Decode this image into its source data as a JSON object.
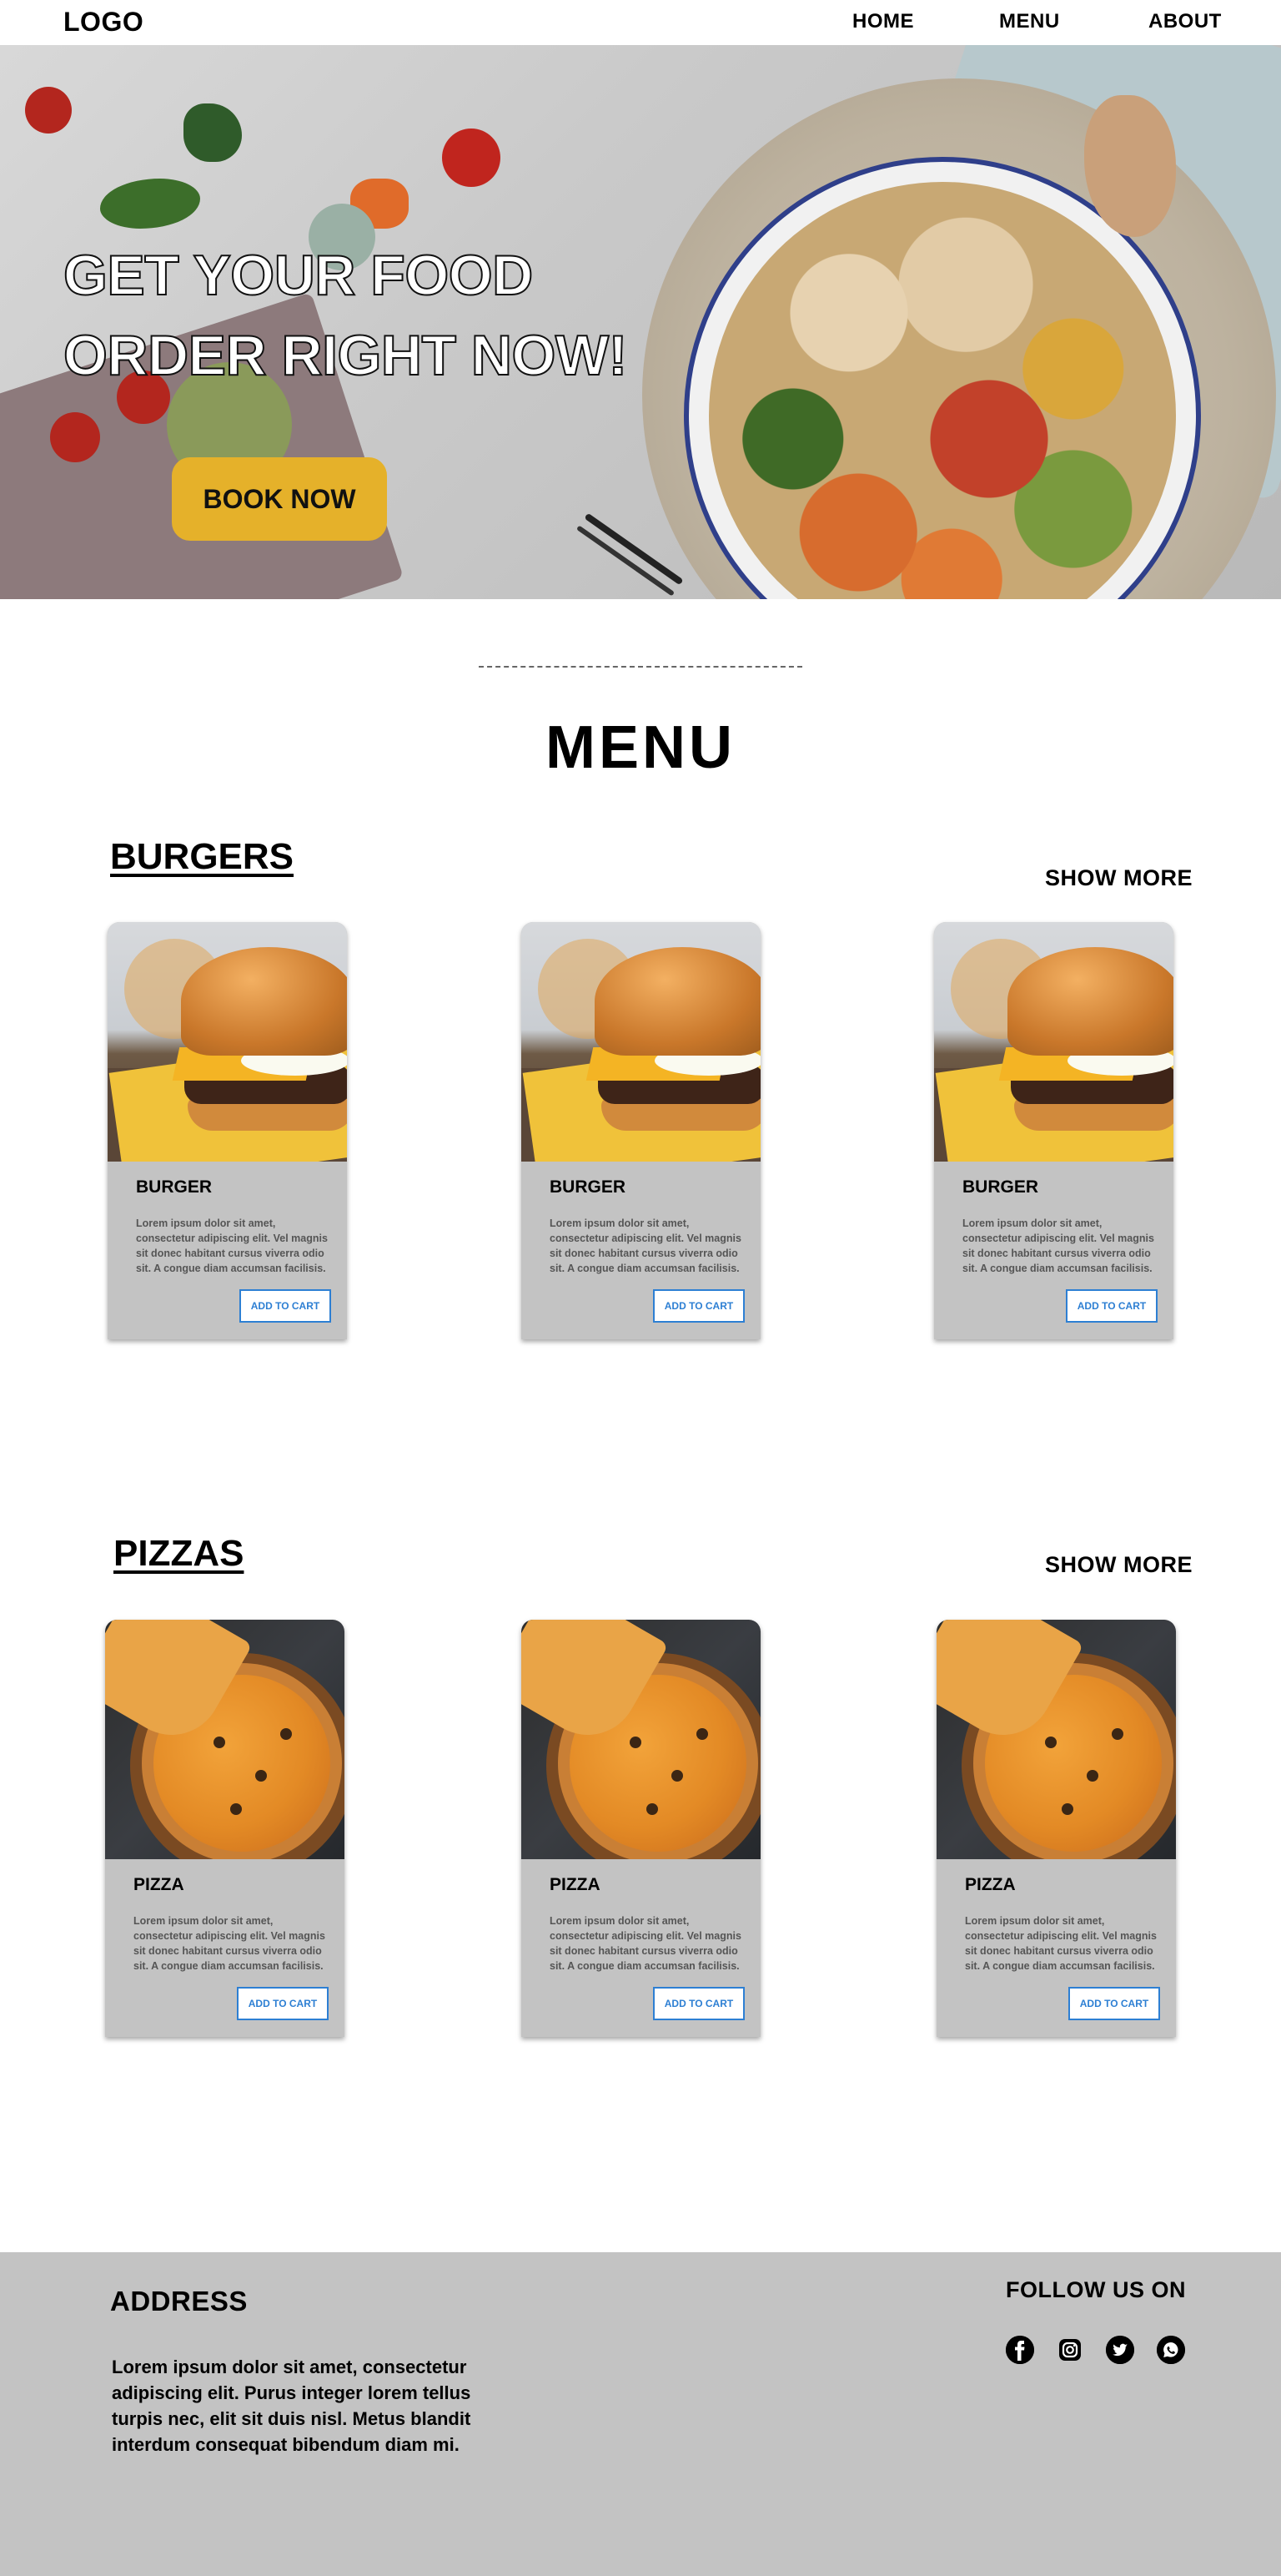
{
  "nav": {
    "logo": "LOGO",
    "links": [
      "HOME",
      "MENU",
      "ABOUT"
    ]
  },
  "hero": {
    "title_line1": "GET YOUR FOOD",
    "title_line2": "ORDER RIGHT NOW!",
    "cta": "BOOK NOW",
    "accent_color": "#e5b12a"
  },
  "menu": {
    "title": "MENU",
    "sections": [
      {
        "title": "BURGERS",
        "show_more": "SHOW MORE",
        "items": [
          {
            "name": "BURGER",
            "description": "Lorem ipsum dolor sit amet, consectetur adipiscing elit. Vel magnis sit donec habitant cursus viverra odio sit. A congue diam accumsan facilisis.",
            "button": "ADD TO CART"
          },
          {
            "name": "BURGER",
            "description": "Lorem ipsum dolor sit amet, consectetur adipiscing elit. Vel magnis sit donec habitant cursus viverra odio sit. A congue diam accumsan facilisis.",
            "button": "ADD TO CART"
          },
          {
            "name": "BURGER",
            "description": "Lorem ipsum dolor sit amet, consectetur adipiscing elit. Vel magnis sit donec habitant cursus viverra odio sit. A congue diam accumsan facilisis.",
            "button": "ADD TO CART"
          }
        ]
      },
      {
        "title": "PIZZAS",
        "show_more": "SHOW MORE",
        "items": [
          {
            "name": "PIZZA",
            "description": "Lorem ipsum dolor sit amet, consectetur adipiscing elit. Vel magnis sit donec habitant cursus viverra odio sit. A congue diam accumsan facilisis.",
            "button": "ADD TO CART"
          },
          {
            "name": "PIZZA",
            "description": "Lorem ipsum dolor sit amet, consectetur adipiscing elit. Vel magnis sit donec habitant cursus viverra odio sit. A congue diam accumsan facilisis.",
            "button": "ADD TO CART"
          },
          {
            "name": "PIZZA",
            "description": "Lorem ipsum dolor sit amet, consectetur adipiscing elit. Vel magnis sit donec habitant cursus viverra odio sit. A congue diam accumsan facilisis.",
            "button": "ADD TO CART"
          }
        ]
      }
    ],
    "button_color": "#2d7fd3",
    "card_color": "#c3c3c3"
  },
  "footer": {
    "address_title": "ADDRESS",
    "address_text": "Lorem ipsum dolor sit amet, consectetur adipiscing elit. Purus integer lorem tellus turpis nec, elit sit duis nisl. Metus blandit interdum consequat bibendum diam mi.",
    "follow_title": "FOLLOW US ON",
    "social_icons": [
      "facebook-icon",
      "instagram-icon",
      "twitter-icon",
      "whatsapp-icon"
    ],
    "background_color": "#c3c3c3"
  }
}
